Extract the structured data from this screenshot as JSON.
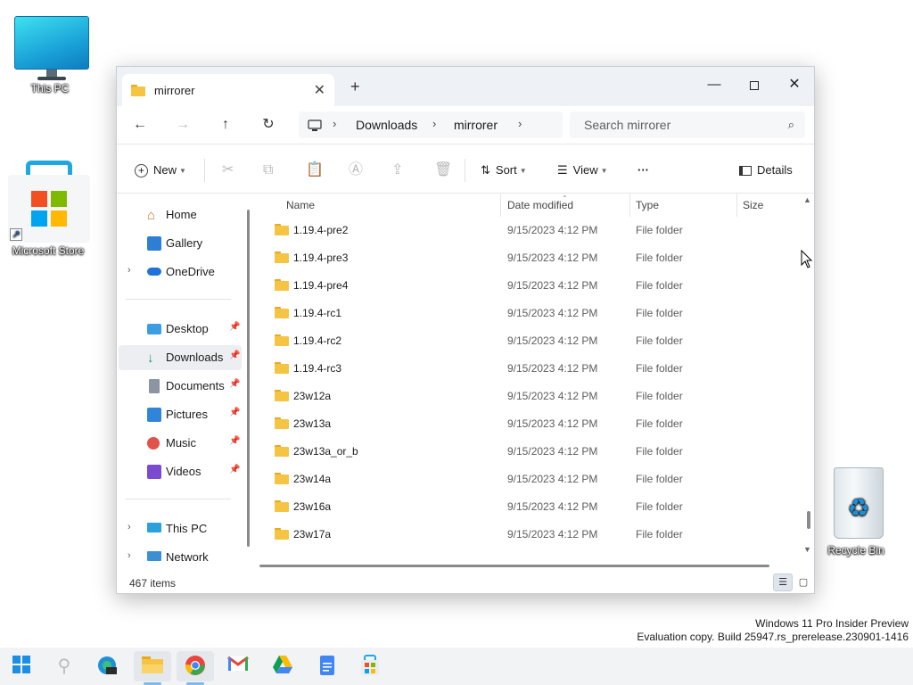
{
  "desktop": {
    "icons": [
      {
        "label": "This PC"
      },
      {
        "label": "Microsoft Store"
      },
      {
        "label": "Recycle Bin"
      }
    ]
  },
  "window": {
    "tab_title": "mirrorer",
    "tab_close": "✕",
    "tab_add": "+",
    "controls": {
      "minimize": "—",
      "close": "✕"
    },
    "nav": {
      "back": "←",
      "forward": "→",
      "up": "↑",
      "refresh": "↻"
    },
    "breadcrumb": [
      "Downloads",
      "mirrorer"
    ],
    "breadcrumb_sep": "›",
    "search_placeholder": "Search mirrorer",
    "search_icon": "⌕",
    "toolbar": {
      "new_label": "New",
      "sort_label": "Sort",
      "view_label": "View",
      "more_label": "···",
      "details_label": "Details"
    },
    "nav_pane": {
      "items": [
        {
          "label": "Home",
          "icon": "home-icon",
          "expandable": false
        },
        {
          "label": "Gallery",
          "icon": "gallery-icon",
          "expandable": false
        },
        {
          "label": "OneDrive",
          "icon": "onedrive-icon",
          "expandable": true
        },
        {
          "label": "Desktop",
          "icon": "desktop-icon",
          "pinned": true
        },
        {
          "label": "Downloads",
          "icon": "downloads-icon",
          "pinned": true,
          "selected": true
        },
        {
          "label": "Documents",
          "icon": "documents-icon",
          "pinned": true
        },
        {
          "label": "Pictures",
          "icon": "pictures-icon",
          "pinned": true
        },
        {
          "label": "Music",
          "icon": "music-icon",
          "pinned": true
        },
        {
          "label": "Videos",
          "icon": "videos-icon",
          "pinned": true
        },
        {
          "label": "This PC",
          "icon": "this-pc-icon",
          "expandable": true
        },
        {
          "label": "Network",
          "icon": "network-icon",
          "expandable": true
        }
      ]
    },
    "columns": [
      "Name",
      "Date modified",
      "Type",
      "Size"
    ],
    "files": [
      {
        "name": "1.19.4-pre2",
        "date": "9/15/2023 4:12 PM",
        "type": "File folder"
      },
      {
        "name": "1.19.4-pre3",
        "date": "9/15/2023 4:12 PM",
        "type": "File folder"
      },
      {
        "name": "1.19.4-pre4",
        "date": "9/15/2023 4:12 PM",
        "type": "File folder"
      },
      {
        "name": "1.19.4-rc1",
        "date": "9/15/2023 4:12 PM",
        "type": "File folder"
      },
      {
        "name": "1.19.4-rc2",
        "date": "9/15/2023 4:12 PM",
        "type": "File folder"
      },
      {
        "name": "1.19.4-rc3",
        "date": "9/15/2023 4:12 PM",
        "type": "File folder"
      },
      {
        "name": "23w12a",
        "date": "9/15/2023 4:12 PM",
        "type": "File folder"
      },
      {
        "name": "23w13a",
        "date": "9/15/2023 4:12 PM",
        "type": "File folder"
      },
      {
        "name": "23w13a_or_b",
        "date": "9/15/2023 4:12 PM",
        "type": "File folder"
      },
      {
        "name": "23w14a",
        "date": "9/15/2023 4:12 PM",
        "type": "File folder"
      },
      {
        "name": "23w16a",
        "date": "9/15/2023 4:12 PM",
        "type": "File folder"
      },
      {
        "name": "23w17a",
        "date": "9/15/2023 4:12 PM",
        "type": "File folder"
      }
    ],
    "status": "467 items"
  },
  "watermark": {
    "line1": "Windows 11 Pro Insider Preview",
    "line2": "Evaluation copy. Build 25947.rs_prerelease.230901-1416"
  },
  "taskbar": {
    "icons": [
      "start-icon",
      "search-icon",
      "edge-icon",
      "file-explorer-icon",
      "chrome-icon",
      "gmail-icon",
      "google-drive-icon",
      "google-docs-icon",
      "microsoft-store-icon"
    ]
  },
  "colors": {
    "accent": "#0067c0",
    "folder": "#f6c443",
    "selection": "#eceef1"
  }
}
